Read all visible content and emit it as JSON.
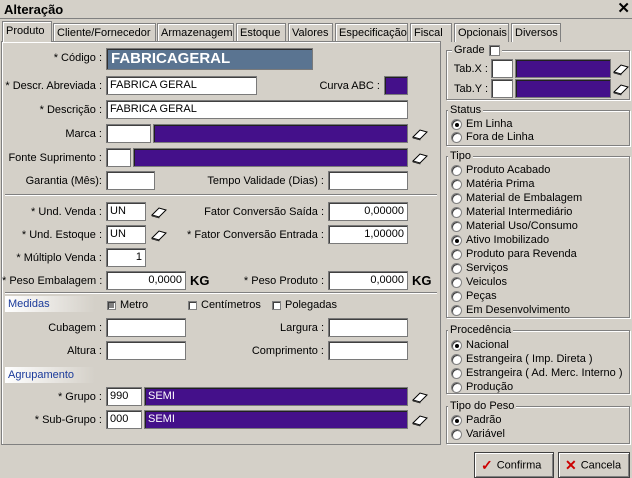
{
  "window": {
    "title": "Alteração",
    "close_glyph": "✕"
  },
  "tabs": [
    "Produto",
    "Cliente/Fornecedor",
    "Armazenagem",
    "Estoque",
    "Valores",
    "Especificação",
    "Fiscal",
    "Opcionais",
    "Diversos"
  ],
  "produto": {
    "codigo_label": "* Código :",
    "codigo_value": "FABRICAGERAL",
    "descr_abrev_label": "* Descr. Abreviada :",
    "descr_abrev_value": "FABRICA GERAL",
    "curva_abc_label": "Curva ABC :",
    "descricao_label": "* Descrição :",
    "descricao_value": "FABRICA GERAL",
    "marca_label": "Marca :",
    "marca_code": "",
    "fonte_label": "Fonte Suprimento :",
    "fonte_code": "",
    "garantia_label": "Garantia (Mês):",
    "garantia_value": "",
    "tempo_validade_label": "Tempo Validade (Dias) :",
    "tempo_validade_value": "",
    "und_venda_label": "* Und. Venda :",
    "und_venda_value": "UN",
    "fator_saida_label": "Fator Conversão Saída :",
    "fator_saida_value": "0,00000",
    "und_estoque_label": "* Und. Estoque :",
    "und_estoque_value": "UN",
    "fator_entrada_label": "* Fator Conversão Entrada :",
    "fator_entrada_value": "1,00000",
    "multiplo_label": "* Múltiplo Venda :",
    "multiplo_value": "1",
    "peso_emb_label": "* Peso Embalagem :",
    "peso_emb_value": "0,0000",
    "peso_emb_unit": "KG",
    "peso_prod_label": "* Peso Produto :",
    "peso_prod_value": "0,0000",
    "peso_prod_unit": "KG"
  },
  "medidas": {
    "header": "Medidas",
    "options": [
      "Metro",
      "Centímetros",
      "Polegadas"
    ],
    "selected": "Metro",
    "cubagem_label": "Cubagem :",
    "cubagem_value": "",
    "largura_label": "Largura :",
    "largura_value": "",
    "altura_label": "Altura :",
    "altura_value": "",
    "comprimento_label": "Comprimento :",
    "comprimento_value": ""
  },
  "agrupamento": {
    "header": "Agrupamento",
    "grupo_label": "* Grupo :",
    "grupo_code": "990",
    "grupo_name": "SEMI",
    "subgrupo_label": "* Sub-Grupo :",
    "subgrupo_code": "000",
    "subgrupo_name": "SEMI"
  },
  "grade": {
    "title": "Grade",
    "checked": false,
    "tabx_label": "Tab.X :",
    "taby_label": "Tab.Y :"
  },
  "status": {
    "title": "Status",
    "options": [
      "Em Linha",
      "Fora de Linha"
    ],
    "selected": "Em Linha"
  },
  "tipo": {
    "title": "Tipo",
    "options": [
      "Produto Acabado",
      "Matéria Prima",
      "Material de Embalagem",
      "Material Intermediário",
      "Material Uso/Consumo",
      "Ativo Imobilizado",
      "Produto para Revenda",
      "Serviços",
      "Veiculos",
      "Peças",
      "Em Desenvolvimento"
    ],
    "selected": "Ativo Imobilizado"
  },
  "procedencia": {
    "title": "Procedência",
    "options": [
      "Nacional",
      "Estrangeira ( Imp. Direta )",
      "Estrangeira ( Ad. Merc. Interno )",
      "Produção"
    ],
    "selected": "Nacional"
  },
  "tipo_peso": {
    "title": "Tipo do Peso",
    "options": [
      "Padrão",
      "Variável"
    ],
    "selected": "Padrão"
  },
  "buttons": {
    "confirma": "Confirma",
    "cancela": "Cancela"
  },
  "colors": {
    "lookup_fill": "#44108a",
    "code_fill": "#5a7491",
    "window_bg": "#d4d0c8"
  }
}
